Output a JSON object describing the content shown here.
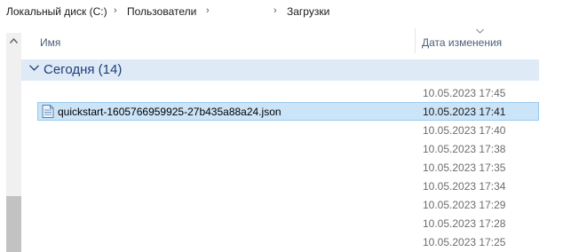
{
  "breadcrumb": {
    "items": [
      "Локальный диск (C:)",
      "Пользователи",
      "Загрузки"
    ],
    "separator": "›"
  },
  "columns": {
    "name": "Имя",
    "date_modified": "Дата изменения"
  },
  "group": {
    "label": "Сегодня (14)"
  },
  "files": [
    {
      "name": "",
      "date": "10.05.2023 17:45",
      "selected": false
    },
    {
      "name": "quickstart-1605766959925-27b435a88a24.json",
      "date": "10.05.2023 17:41",
      "selected": true
    },
    {
      "name": "",
      "date": "10.05.2023 17:40",
      "selected": false
    },
    {
      "name": "",
      "date": "10.05.2023 17:38",
      "selected": false
    },
    {
      "name": "",
      "date": "10.05.2023 17:35",
      "selected": false
    },
    {
      "name": "",
      "date": "10.05.2023 17:34",
      "selected": false
    },
    {
      "name": "",
      "date": "10.05.2023 17:29",
      "selected": false
    },
    {
      "name": "",
      "date": "10.05.2023 17:28",
      "selected": false
    },
    {
      "name": "",
      "date": "10.05.2023 17:25",
      "selected": false
    }
  ],
  "icons": {
    "scroll_up": "chevron-up-icon",
    "group_toggle": "chevron-down-icon",
    "sort": "sort-descending-icon",
    "file": "json-file-icon"
  },
  "colors": {
    "selection": "#cce4f7",
    "selection_border": "#99c9ef",
    "group_header": "#dfeaf7",
    "group_text": "#1e3d7a"
  }
}
